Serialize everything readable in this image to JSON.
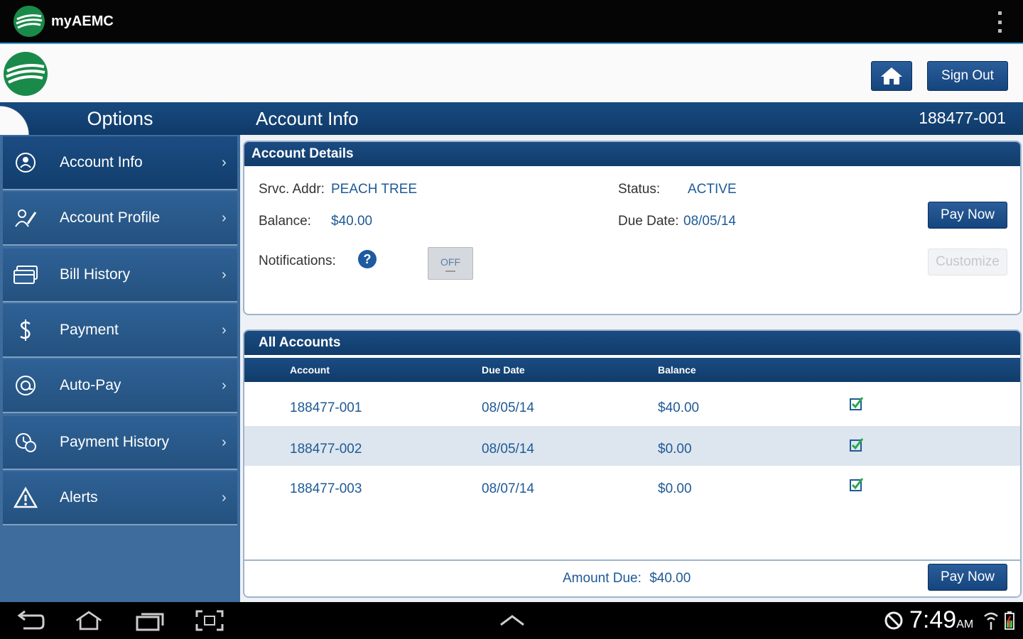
{
  "app": {
    "title": "myAEMC"
  },
  "header": {
    "signout_label": "Sign Out"
  },
  "sidebar": {
    "title": "Options",
    "items": [
      {
        "label": "Account Info",
        "icon": "account-info-icon"
      },
      {
        "label": "Account Profile",
        "icon": "profile-icon"
      },
      {
        "label": "Bill History",
        "icon": "bill-icon"
      },
      {
        "label": "Payment",
        "icon": "dollar-icon"
      },
      {
        "label": "Auto-Pay",
        "icon": "autopay-icon"
      },
      {
        "label": "Payment History",
        "icon": "payment-history-icon"
      },
      {
        "label": "Alerts",
        "icon": "alert-icon"
      }
    ]
  },
  "content": {
    "title": "Account Info",
    "account_number": "188477-001"
  },
  "details": {
    "title": "Account Details",
    "srvc_label": "Srvc. Addr:",
    "srvc_value": "PEACH TREE",
    "status_label": "Status:",
    "status_value": "ACTIVE",
    "balance_label": "Balance:",
    "balance_value": "$40.00",
    "due_label": "Due Date:",
    "due_value": "08/05/14",
    "notifications_label": "Notifications:",
    "help_glyph": "?",
    "toggle_label": "OFF",
    "pay_now_label": "Pay Now",
    "customize_label": "Customize"
  },
  "accounts": {
    "title": "All Accounts",
    "columns": [
      "Account",
      "Due Date",
      "Balance"
    ],
    "rows": [
      {
        "account": "188477-001",
        "due": "08/05/14",
        "balance": "$40.00"
      },
      {
        "account": "188477-002",
        "due": "08/05/14",
        "balance": "$0.00"
      },
      {
        "account": "188477-003",
        "due": "08/07/14",
        "balance": "$0.00"
      }
    ],
    "amount_due_label": "Amount Due:",
    "amount_due_value": "$40.00",
    "pay_now_label": "Pay Now"
  },
  "system": {
    "time": "7:49",
    "ampm": "AM"
  },
  "colors": {
    "primary": "#15457e",
    "sidebar": "#3e6c9c",
    "link": "#1e5a96",
    "accent_green": "#1a8a4a"
  }
}
